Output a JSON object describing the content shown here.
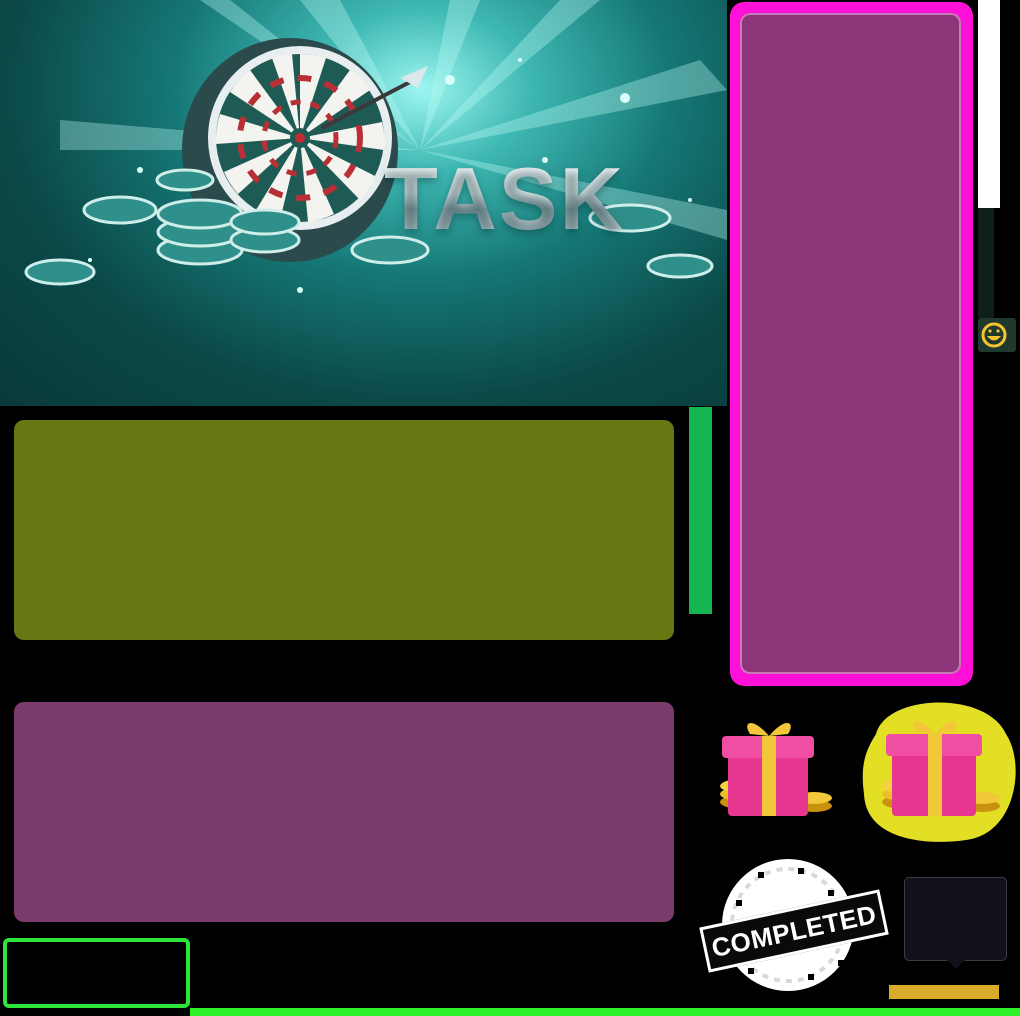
{
  "banner": {
    "title": "TASK"
  },
  "stamp": {
    "label": "COMPLETED"
  },
  "colors": {
    "olive_panel": "#667811",
    "purple_panel": "#7b3a6c",
    "magenta_frame": "#ff10d8",
    "magenta_fill": "#8c3578",
    "green_strip": "#15b551",
    "green_outline": "#2ee53a",
    "gold_bar": "#d8ab2a"
  },
  "icons": {
    "banner_art": "dartboard-with-chips",
    "gift": "gift-box-with-coins-icon",
    "gift_selected": "gift-box-with-coins-glow-icon",
    "emoji": "smiley-icon"
  }
}
